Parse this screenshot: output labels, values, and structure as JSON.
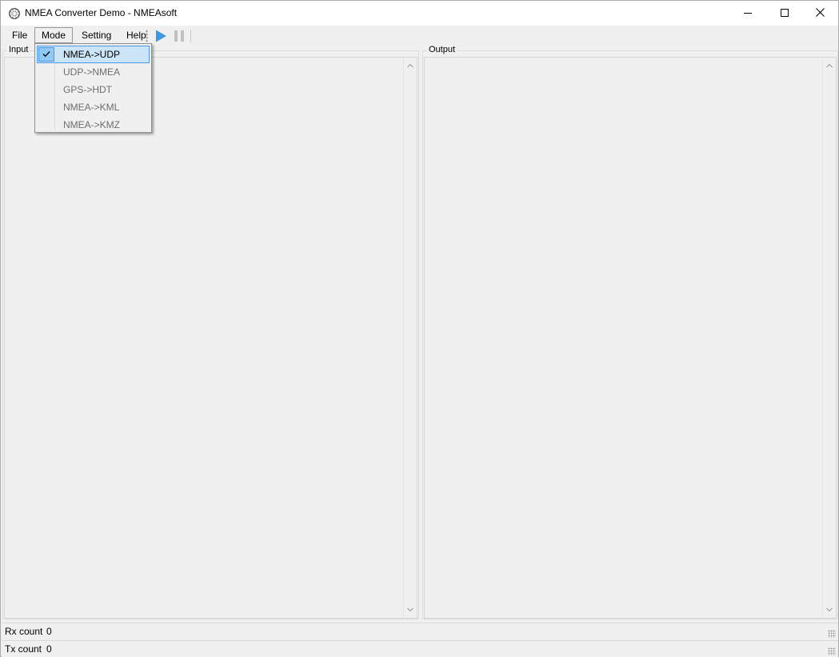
{
  "window": {
    "title": "NMEA Converter Demo - NMEAsoft",
    "icons": {
      "app": "ship-wheel-icon",
      "minimize": "minimize-icon",
      "maximize": "maximize-icon",
      "close": "close-icon"
    }
  },
  "menubar": {
    "items": [
      {
        "label": "File"
      },
      {
        "label": "Mode"
      },
      {
        "label": "Setting"
      },
      {
        "label": "Help"
      }
    ]
  },
  "toolbar": {
    "play_icon": "play-icon",
    "pause_icon": "pause-icon",
    "colors": {
      "play": "#3c9be0",
      "pause": "#c0c0c0"
    }
  },
  "mode_menu": {
    "items": [
      {
        "label": "NMEA->UDP",
        "checked": true
      },
      {
        "label": "UDP->NMEA",
        "checked": false
      },
      {
        "label": "GPS->HDT",
        "checked": false
      },
      {
        "label": "NMEA->KML",
        "checked": false
      },
      {
        "label": "NMEA->KMZ",
        "checked": false
      }
    ],
    "colors": {
      "highlight": "#cce4f7",
      "highlight_border": "#4d98e0",
      "disabled_text": "#6d6d6d"
    }
  },
  "panels": {
    "input": {
      "label": "Input"
    },
    "output": {
      "label": "Output"
    }
  },
  "status": {
    "rx": {
      "label": "Rx count",
      "value": "0"
    },
    "tx": {
      "label": "Tx count",
      "value": "0"
    }
  }
}
